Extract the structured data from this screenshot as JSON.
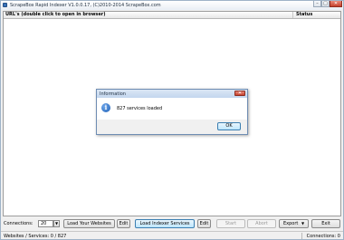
{
  "window": {
    "title": "ScrapeBox Rapid Indexer V1.0.0.17, (C)2010-2014 ScrapeBox.com",
    "minimize_glyph": "–",
    "maximize_glyph": "□",
    "close_glyph": "✕"
  },
  "grid": {
    "columns": [
      "URL's (double click to open in browser)",
      "Status"
    ]
  },
  "dialog": {
    "title": "Information",
    "close_glyph": "✕",
    "icon": "information-icon",
    "icon_glyph": "i",
    "message": "827 services loaded",
    "ok_label": "OK"
  },
  "toolbar": {
    "connections_label": "Connections:",
    "connections_value": "20",
    "dropdown_glyph": "▼",
    "load_websites_label": "Load Your Websites",
    "edit_websites_label": "Edit",
    "load_services_label": "Load Indexer Services",
    "edit_services_label": "Edit",
    "start_label": "Start",
    "abort_label": "Abort",
    "export_label": "Export",
    "export_glyph": "▼",
    "exit_label": "Exit"
  },
  "statusbar": {
    "left": "Websites / Services:   0 / 827",
    "right": "Connections: 0"
  },
  "colors": {
    "accent": "#3c7fb1",
    "close": "#c6412d"
  }
}
